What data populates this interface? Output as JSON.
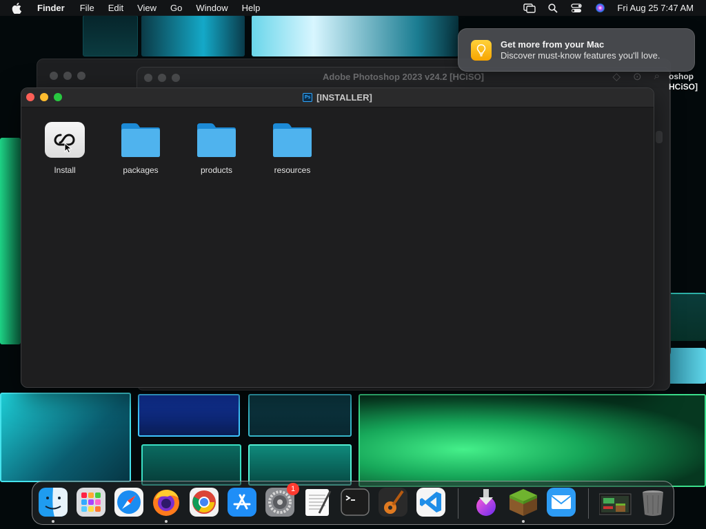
{
  "menubar": {
    "apple_icon": "apple-logo",
    "app_name": "Finder",
    "items": [
      "File",
      "Edit",
      "View",
      "Go",
      "Window",
      "Help"
    ],
    "status_icons": [
      "screen-mirroring-icon",
      "spotlight-search-icon",
      "control-center-icon",
      "siri-icon"
    ],
    "clock": "Fri Aug 25  7:47 AM"
  },
  "notification": {
    "icon": "lightbulb-icon",
    "title": "Get more from your Mac",
    "body": "Discover must-know features you'll love."
  },
  "background_window": {
    "title": "Adobe Photoshop 2023 v24.2 [HCiSO]",
    "side_fragment_line1": "oshop",
    "side_fragment_line2": "HCiSO]"
  },
  "finder_window": {
    "title": "[INSTALLER]",
    "title_icon": "photoshop-file-icon",
    "items": [
      {
        "label": "Install",
        "icon": "creative-cloud-installer-icon"
      },
      {
        "label": "packages",
        "icon": "folder-icon"
      },
      {
        "label": "products",
        "icon": "folder-icon"
      },
      {
        "label": "resources",
        "icon": "folder-icon"
      }
    ]
  },
  "dock": {
    "apps": [
      {
        "name": "Finder",
        "running": true
      },
      {
        "name": "Launchpad",
        "running": false
      },
      {
        "name": "Safari",
        "running": false
      },
      {
        "name": "Firefox",
        "running": true
      },
      {
        "name": "Chrome",
        "running": false
      },
      {
        "name": "App Store",
        "running": false
      },
      {
        "name": "System Settings",
        "running": false,
        "badge": "1"
      },
      {
        "name": "TextEdit",
        "running": false
      },
      {
        "name": "Terminal",
        "running": false
      },
      {
        "name": "GarageBand",
        "running": false
      },
      {
        "name": "Visual Studio Code",
        "running": false
      },
      {
        "name": "Downloader",
        "running": false
      },
      {
        "name": "Minecraft",
        "running": true
      },
      {
        "name": "Mail",
        "running": false
      },
      {
        "name": "Recent Document",
        "running": false
      },
      {
        "name": "Trash",
        "running": false
      }
    ]
  }
}
